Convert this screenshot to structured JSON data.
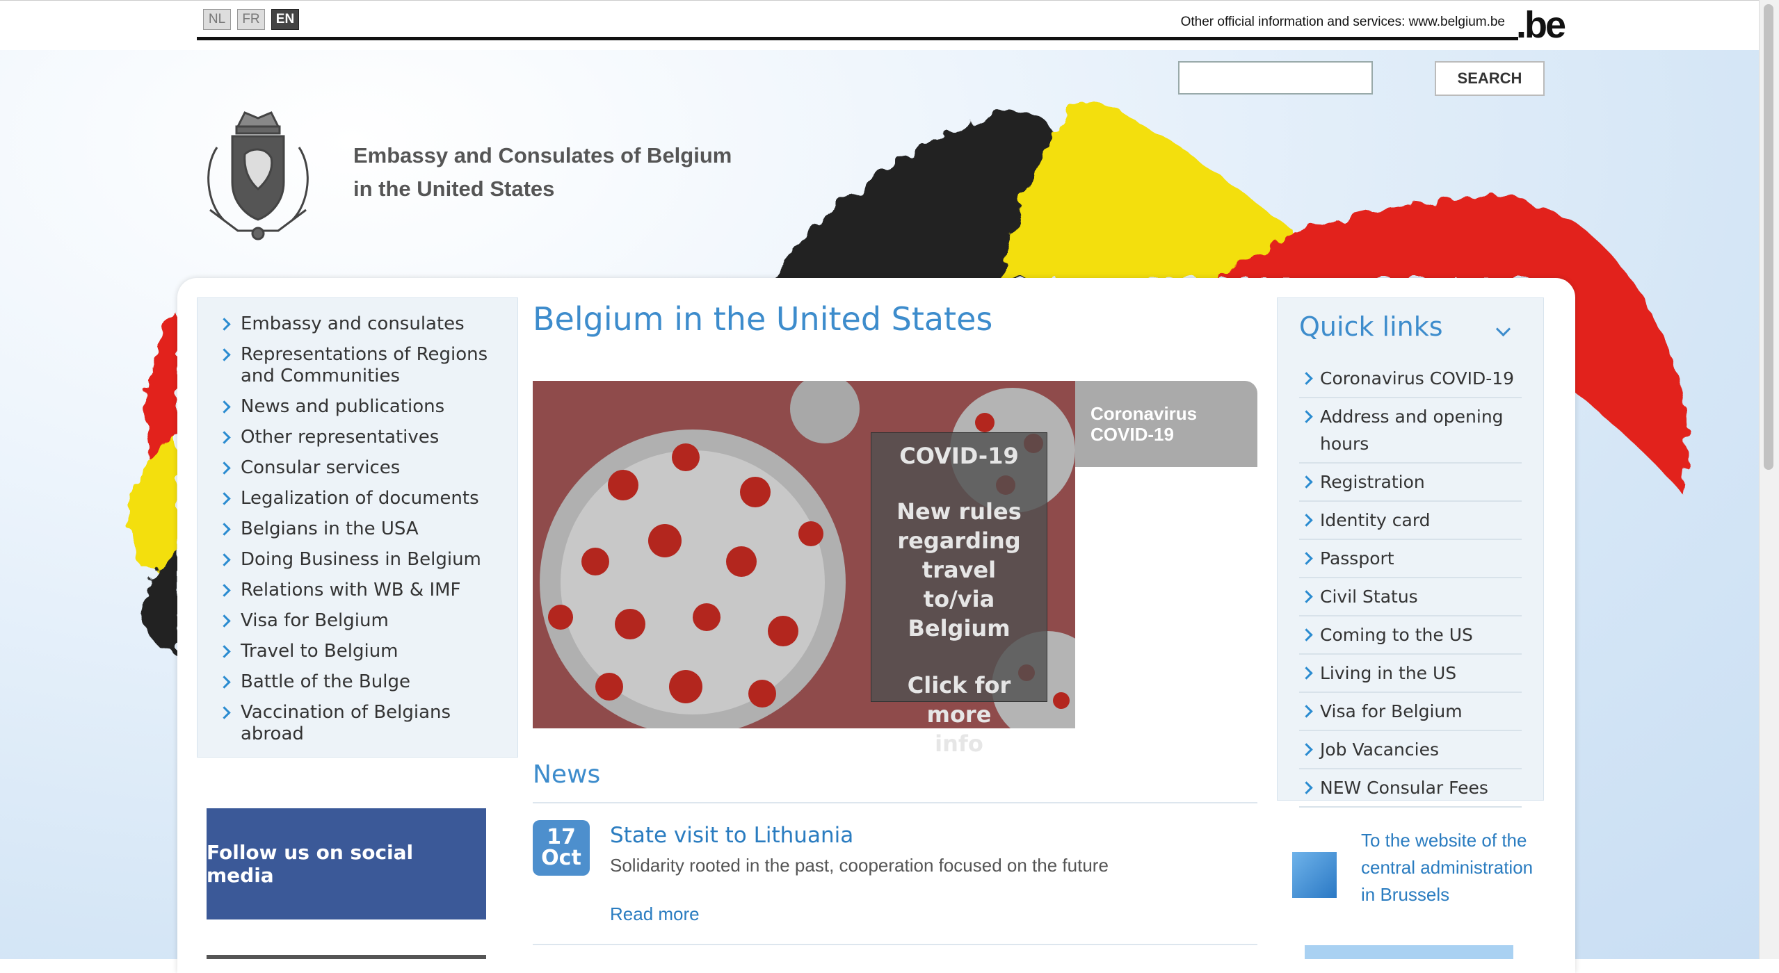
{
  "languages": [
    "NL",
    "FR",
    "EN"
  ],
  "active_language": "EN",
  "official_info": "Other official information and services: www.belgium.be",
  "be_logo": ".be",
  "search": {
    "placeholder": "",
    "button": "SEARCH"
  },
  "site_title": {
    "line1": "Embassy and Consulates of Belgium",
    "line2": "in the United States"
  },
  "left_nav": [
    "Embassy and consulates",
    "Representations of Regions and Communities",
    "News and publications",
    "Other representatives",
    "Consular services",
    "Legalization of documents",
    "Belgians in the USA",
    "Doing Business in Belgium",
    "Relations with WB & IMF",
    "Visa for Belgium",
    "Travel to Belgium",
    "Battle of the Bulge",
    "Vaccination of Belgians abroad"
  ],
  "social_button": "Follow us on social media",
  "page_title": "Belgium in the United States",
  "hero": {
    "tab_line1": "Coronavirus",
    "tab_line2": "COVID-19",
    "box_title": "COVID-19",
    "box_line1": "New rules",
    "box_line2": "regarding travel",
    "box_line3": "to/via",
    "box_line4": "Belgium",
    "box_line5": "Click for more",
    "box_line6": "info"
  },
  "news": {
    "title": "News",
    "date_day": "17",
    "date_month": "Oct",
    "headline": "State visit to Lithuania",
    "summary": "Solidarity rooted in the past, cooperation focused on the future",
    "read_more": "Read more"
  },
  "quick_links": {
    "title": "Quick links",
    "items": [
      "Coronavirus COVID-19",
      "Address and opening hours",
      "Registration",
      "Identity card",
      "Passport",
      "Civil Status",
      "Coming to the US",
      "Living in the US",
      "Visa for Belgium",
      "Job Vacancies",
      "NEW Consular Fees"
    ]
  },
  "admin_link": "To the website of the central administration in Brussels",
  "colors": {
    "accent": "#3d8ccc",
    "link": "#2a7cc0",
    "social": "#3b5998",
    "flag_black": "#222222",
    "flag_yellow": "#f5e000",
    "flag_red": "#e2231a"
  }
}
